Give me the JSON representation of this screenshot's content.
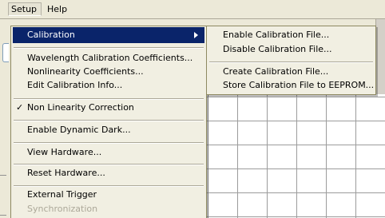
{
  "menubar": {
    "setup": "Setup",
    "help": "Help"
  },
  "setup_menu": {
    "calibration": "Calibration",
    "wavelength_coeffs": "Wavelength Calibration Coefficients...",
    "nonlinearity_coeffs": "Nonlinearity Coefficients...",
    "edit_cal_info": "Edit Calibration Info...",
    "check_mark": "✓",
    "nonlinearity_correction": "Non Linearity Correction",
    "enable_dynamic_dark": "Enable Dynamic Dark...",
    "view_hardware": "View Hardware...",
    "reset_hardware": "Reset Hardware...",
    "external_trigger": "External Trigger",
    "synchronization": "Synchronization"
  },
  "calibration_submenu": {
    "enable_cal_file": "Enable Calibration File...",
    "disable_cal_file": "Disable Calibration File...",
    "create_cal_file": "Create Calibration File...",
    "store_cal_file": "Store Calibration File to EEPROM..."
  },
  "icons": {
    "submenu_arrow": "chevron-right-icon",
    "checked": "checkmark-icon"
  },
  "colors": {
    "highlight_bg": "#0a246a",
    "menu_bg": "#f1efe2",
    "disabled_text": "#aca899"
  }
}
